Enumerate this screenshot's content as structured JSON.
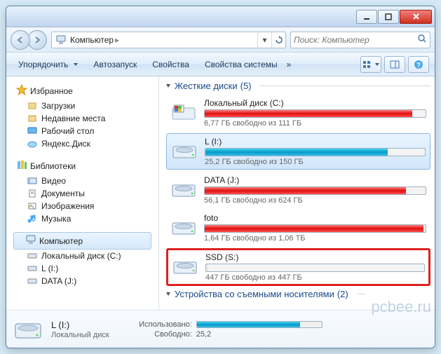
{
  "breadcrumb": {
    "root": "Компьютер",
    "sep": "▸"
  },
  "search": {
    "placeholder": "Поиск: Компьютер"
  },
  "toolbar": {
    "organize": "Упорядочить",
    "autorun": "Автозапуск",
    "properties": "Свойства",
    "system_properties": "Свойства системы"
  },
  "nav": {
    "favorites": {
      "label": "Избранное",
      "items": [
        "Загрузки",
        "Недавние места",
        "Рабочий стол",
        "Яндекс.Диск"
      ]
    },
    "libraries": {
      "label": "Библиотеки",
      "items": [
        "Видео",
        "Документы",
        "Изображения",
        "Музыка"
      ]
    },
    "computer": {
      "label": "Компьютер",
      "items": [
        "Локальный диск (C:)",
        "L (I:)",
        "DATA (J:)"
      ]
    }
  },
  "sections": {
    "hdd": {
      "title": "Жесткие диски",
      "count": "(5)"
    },
    "removable": {
      "title": "Устройства со съемными носителями",
      "count": "(2)"
    }
  },
  "drives": [
    {
      "name": "Локальный диск (C:)",
      "stat": "6,77 ГБ свободно из 111 ГБ",
      "fill": 94,
      "color": "red",
      "selected": false,
      "kind": "os"
    },
    {
      "name": "L (I:)",
      "stat": "25,2 ГБ свободно из 150 ГБ",
      "fill": 83,
      "color": "blue",
      "selected": true,
      "kind": "hdd"
    },
    {
      "name": "DATA (J:)",
      "stat": "56,1 ГБ свободно из 624 ГБ",
      "fill": 91,
      "color": "red",
      "selected": false,
      "kind": "hdd"
    },
    {
      "name": "foto",
      "stat": "1,64 ГБ свободно из 1,06 ТБ",
      "fill": 99,
      "color": "red",
      "selected": false,
      "kind": "hdd"
    },
    {
      "name": "SSD (S:)",
      "stat": "447 ГБ свободно из 447 ГБ",
      "fill": 1,
      "color": "gray",
      "selected": false,
      "kind": "hdd",
      "highlight": true
    }
  ],
  "detail": {
    "name": "L (I:)",
    "type": "Локальный диск",
    "used_label": "Использовано:",
    "free_label": "Свободно:",
    "free_value": "25,2",
    "fill": 83
  },
  "watermark": "pcbee.ru"
}
